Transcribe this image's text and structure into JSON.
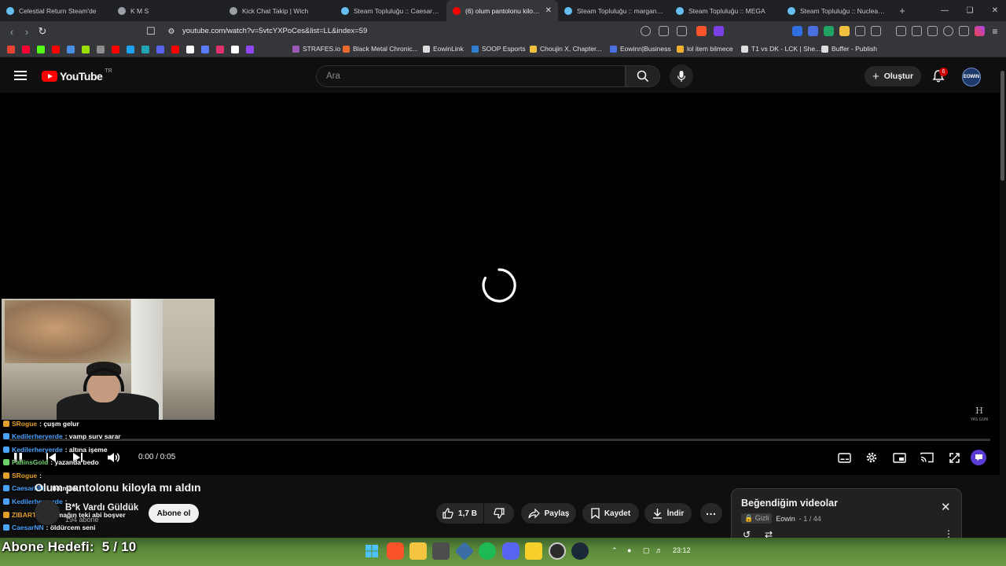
{
  "browser": {
    "tabs": [
      {
        "title": "Celestial Return Steam'de",
        "color": "#66c0f4"
      },
      {
        "title": "K M S",
        "color": "#9aa0a6"
      },
      {
        "title": "Kick Chat Takip | Wich",
        "color": "#9aa0a6"
      },
      {
        "title": "Steam Topluluğu :: CaesarNN",
        "color": "#66c0f4"
      },
      {
        "title": "(6) olum pantolonu kiloyla",
        "color": "#ff0000",
        "active": true
      },
      {
        "title": "Steam Topluluğu :: marganajer",
        "color": "#66c0f4"
      },
      {
        "title": "Steam Topluluğu :: MEGA",
        "color": "#66c0f4"
      },
      {
        "title": "Steam Topluluğu :: Nuclear Vor",
        "color": "#66c0f4"
      }
    ],
    "url": "youtube.com/watch?v=5vtcYXPoCes&list=LL&index=59",
    "bookmarks": [
      {
        "label": "STRAFES.io",
        "color": "#9b59b6"
      },
      {
        "label": "Black Metal Chronic...",
        "color": "#e86a2e"
      },
      {
        "label": "EowinLink",
        "color": "#dddddd"
      },
      {
        "label": "SOOP Esports",
        "color": "#2e7dd1"
      },
      {
        "label": "Choujin X, Chapter...",
        "color": "#f0c040"
      },
      {
        "label": "Eowinn|Business",
        "color": "#4a6fe0"
      },
      {
        "label": "lol item bilmece",
        "color": "#f0b030"
      },
      {
        "label": "T1 vs DK - LCK | She...",
        "color": "#dddddd"
      },
      {
        "label": "Buffer - Publish",
        "color": "#dddddd"
      }
    ],
    "bookmark_icons": [
      "#ea4335",
      "#ff0033",
      "#53fc18",
      "#ff0000",
      "#4a90e2",
      "#9be000",
      "#8e8e8e",
      "#ff0000",
      "#1da1f2",
      "#22a6b3",
      "#5865f2",
      "#ff0000",
      "#ffffff",
      "#5b7cfa",
      "#e1306c",
      "#ffffff",
      "#9146ff"
    ]
  },
  "youtube": {
    "logo_text": "YouTube",
    "country": "TR",
    "search_placeholder": "Ara",
    "create_label": "Oluştur",
    "notification_count": "6",
    "avatar_label": "EOWIN"
  },
  "player": {
    "time": "0:00 / 0:05",
    "watermark": "H\nYAS GUN"
  },
  "chat": [
    {
      "name": "SRogue",
      "msg": ": çuşm gelur",
      "color": "#e6a02a"
    },
    {
      "name": "Kedilerheryerde",
      "msg": ": vamp surv sarar",
      "color": "#4aa3ff"
    },
    {
      "name": "Kedilerheryerde",
      "msg": ": altına işeme",
      "color": "#4aa3ff"
    },
    {
      "name": "FallinsGold",
      "msg": ": yazanda bedo",
      "color": "#6ad36a"
    },
    {
      "name": "SRogue",
      "msg": ":",
      "color": "#e6a02a"
    },
    {
      "name": "CaesarNN",
      "msg": ": :batman:",
      "color": "#4aa3ff"
    },
    {
      "name": "Kedilerheryerde",
      "msg": ":",
      "color": "#4aa3ff"
    },
    {
      "name": "ZIBARTIC",
      "msg": ": ahmağın teki abi boşver",
      "color": "#e6a02a"
    },
    {
      "name": "CaesarNN",
      "msg": ": öldürcem seni",
      "color": "#4aa3ff"
    }
  ],
  "video": {
    "title": "Olum pantolonu kiloyla mı aldın",
    "channel": "B*k Vardı Güldük",
    "subscribers": "194 abone",
    "subscribe_label": "Abone ol",
    "likes": "1,7 B",
    "share_label": "Paylaş",
    "save_label": "Kaydet",
    "download_label": "İndir"
  },
  "playlist": {
    "title": "Beğendiğim videolar",
    "privacy": "Gizli",
    "owner": "Eowin",
    "position": "- 1 / 44"
  },
  "stream_overlay": {
    "goal_label": "Abone Hedefi:",
    "goal_value": "5 / 10"
  },
  "taskbar": {
    "clock": "23:12"
  }
}
